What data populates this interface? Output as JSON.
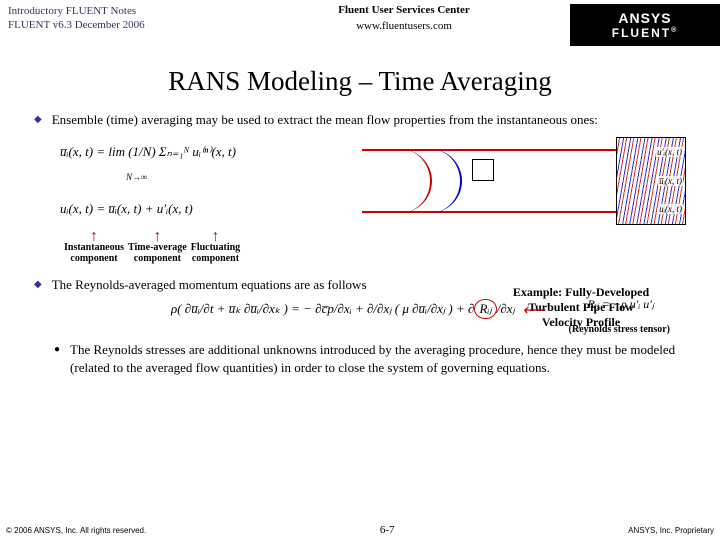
{
  "header": {
    "line1": "Introductory FLUENT Notes",
    "line2": "FLUENT v6.3 December 2006",
    "service": "Fluent User Services Center",
    "url": "www.fluentusers.com",
    "brand_top": "ANSYS",
    "brand_bot": "FLUENT"
  },
  "title": "RANS Modeling – Time Averaging",
  "bullets": {
    "b1": "Ensemble (time) averaging may be used to extract the mean flow properties from the instantaneous ones:",
    "b2": "The Reynolds-averaged momentum equations are as follows",
    "sub1": "The Reynolds stresses are additional unknowns introduced by the averaging procedure, hence they must be modeled (related to the averaged flow quantities) in order to close the system of governing equations."
  },
  "equations": {
    "eq1": "u̅ᵢ(x, t) = lim (1/N) Σₙ₌₁ᴺ uᵢ⁽ⁿ⁾(x, t)",
    "eq1_sub": "N→∞",
    "eq2": "uᵢ(x, t) = u̅ᵢ(x, t) + u′ᵢ(x, t)",
    "momentum": "ρ( ∂u̅ᵢ/∂t + u̅ₖ ∂u̅ᵢ/∂xₖ ) = − ∂c̅p/∂xᵢ + ∂/∂xⱼ ( μ ∂u̅ᵢ/∂xⱼ ) + ∂",
    "rij_circled": "Rᵢⱼ",
    "over_xj": "/∂xⱼ",
    "rij_def": "Rᵢⱼ = −ρ u′ᵢ u′ⱼ"
  },
  "arrow_labels": {
    "a1_l1": "Instantaneous",
    "a1_l2": "component",
    "a2_l1": "Time-average",
    "a2_l2": "component",
    "a3_l1": "Fluctuating",
    "a3_l2": "component"
  },
  "example": {
    "l1": "Example:  Fully-Developed",
    "l2": "Turbulent Pipe Flow",
    "l3": "Velocity Profile"
  },
  "detail_labels": {
    "d1": "u′ᵢ(x, t)",
    "d2": "u̅ᵢ(x, t)",
    "d3": "uᵢ(x, t)"
  },
  "stress_label": "(Reynolds stress tensor)",
  "footer": {
    "left": "© 2006 ANSYS, Inc. All rights reserved.",
    "center": "6-7",
    "right": "ANSYS, Inc. Proprietary"
  }
}
